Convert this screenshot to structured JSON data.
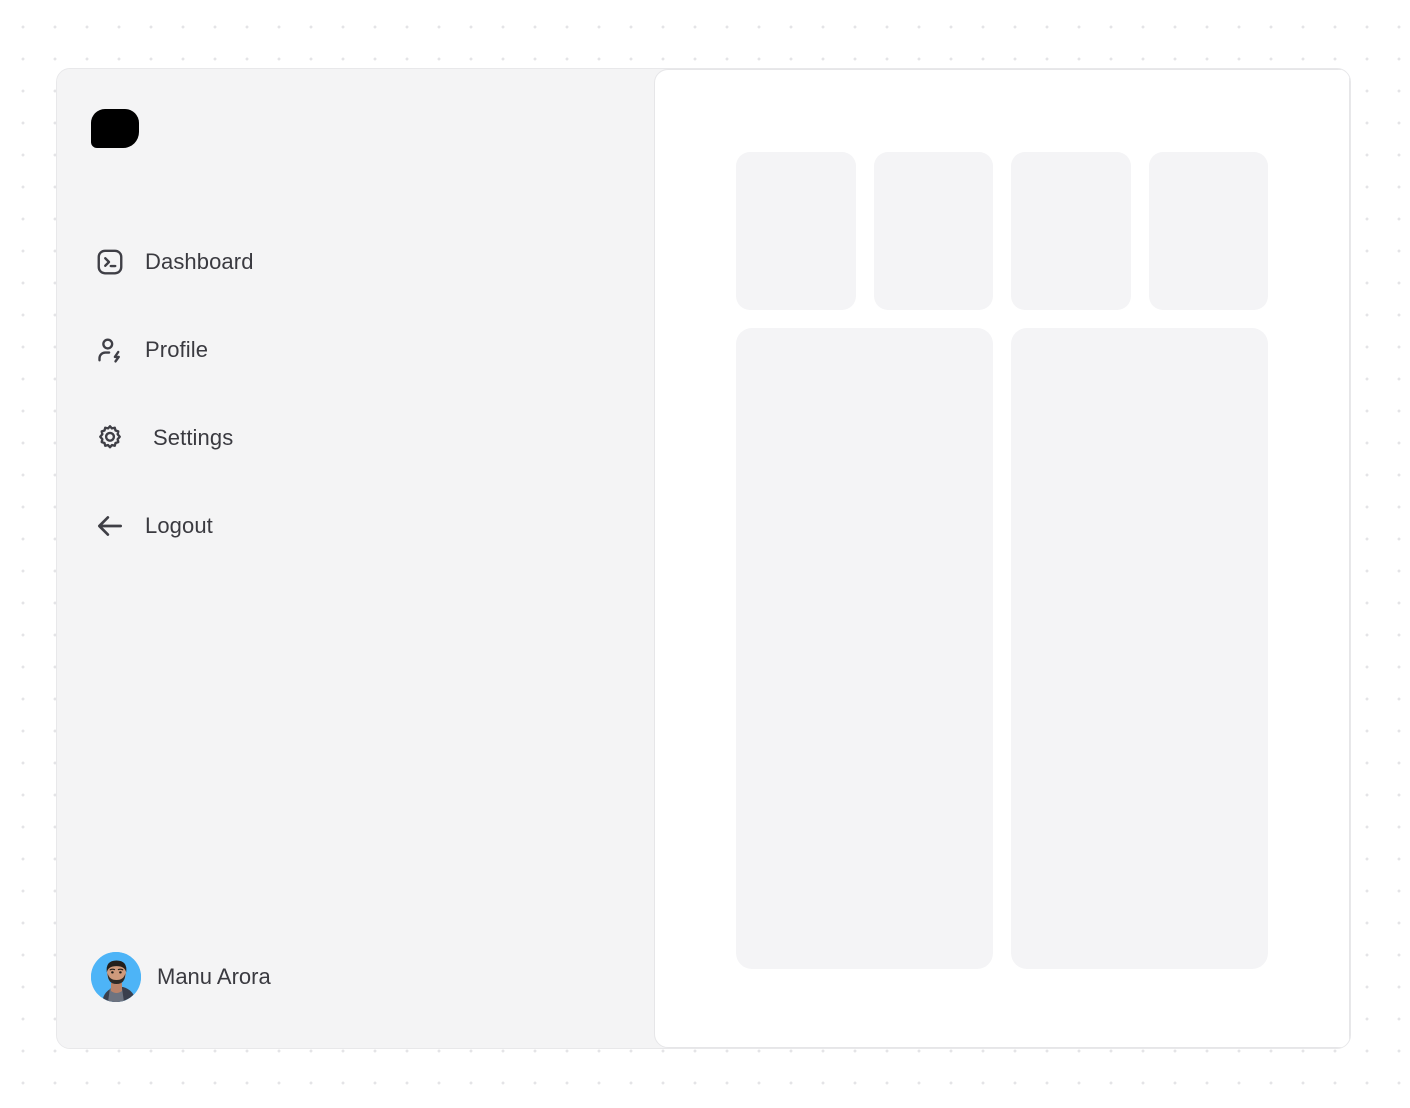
{
  "app": {
    "logo_name": "app-logo-mark",
    "accent_black": "#000000",
    "surface": "#f4f4f5",
    "panel": "#ffffff",
    "skeleton": "#f4f4f6",
    "text": "#3a3a40",
    "dot_grid": "#e4e4e7"
  },
  "sidebar": {
    "items": [
      {
        "label": "Dashboard",
        "icon": "terminal-square-icon"
      },
      {
        "label": "Profile",
        "icon": "user-bolt-icon"
      },
      {
        "label": "Settings",
        "icon": "gear-icon"
      },
      {
        "label": "Logout",
        "icon": "arrow-left-icon"
      }
    ],
    "user": {
      "name": "Manu Arora",
      "avatar": "user-avatar-photo",
      "avatar_background": "#4db4f7"
    }
  },
  "main": {
    "state": "loading-skeleton",
    "top_cards": [
      {
        "id": "stat-card-1"
      },
      {
        "id": "stat-card-2"
      },
      {
        "id": "stat-card-3"
      },
      {
        "id": "stat-card-4"
      }
    ],
    "bottom_cards": [
      {
        "id": "panel-card-1"
      },
      {
        "id": "panel-card-2"
      }
    ]
  }
}
